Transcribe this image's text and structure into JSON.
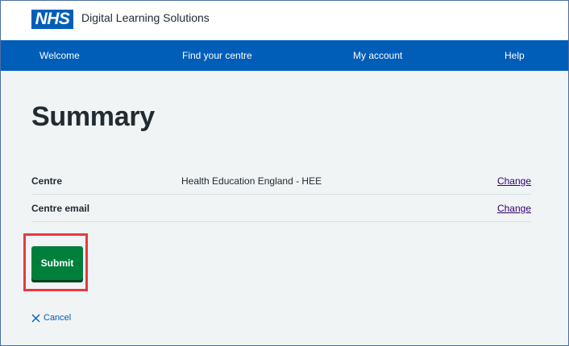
{
  "header": {
    "logo_text": "NHS",
    "service_name": "Digital Learning Solutions"
  },
  "nav": {
    "items": [
      {
        "label": "Welcome"
      },
      {
        "label": "Find your centre"
      },
      {
        "label": "My account"
      },
      {
        "label": "Help"
      }
    ]
  },
  "main": {
    "title": "Summary",
    "summary_rows": [
      {
        "key": "Centre",
        "value": "Health Education England - HEE",
        "action": "Change"
      },
      {
        "key": "Centre email",
        "value": "",
        "action": "Change"
      }
    ],
    "submit_label": "Submit",
    "cancel_label": "Cancel"
  },
  "colors": {
    "brand_blue": "#005eb8",
    "submit_green": "#007f3b",
    "highlight_red": "#e8393f",
    "link_visited": "#330072",
    "page_bg": "#f0f4f5"
  },
  "icons": {
    "cancel": "close-icon"
  }
}
